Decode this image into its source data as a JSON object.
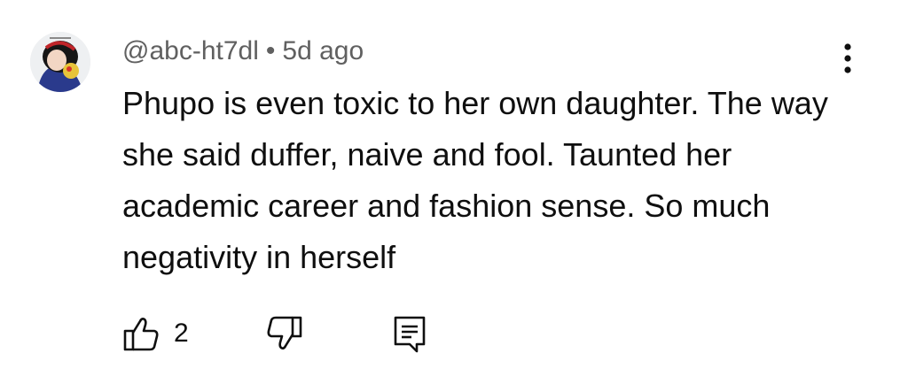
{
  "comment": {
    "author": "@abc-ht7dl",
    "separator": "•",
    "time": "5d ago",
    "text": "Phupo is even toxic to her own daughter. The way she said duffer, naive and fool. Taunted her academic career and fashion sense. So much negativity in herself",
    "like_count": "2"
  },
  "icons": {
    "avatar": "avatar-illustration",
    "more": "more-vertical-icon",
    "like": "thumbs-up-icon",
    "dislike": "thumbs-down-icon",
    "reply": "reply-comment-icon"
  },
  "colors": {
    "text": "#0f0f0f",
    "meta": "#606060",
    "background": "#ffffff"
  }
}
